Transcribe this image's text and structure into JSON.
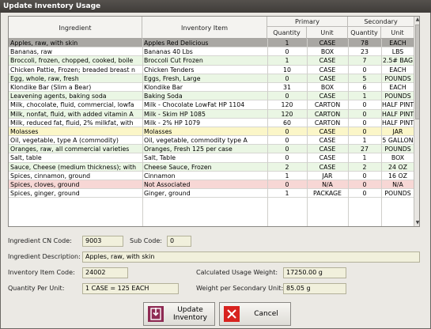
{
  "window": {
    "title": "Update Inventory Usage"
  },
  "table": {
    "headers": {
      "ingredient": "Ingredient",
      "inventory_item": "Inventory Item",
      "primary": "Primary",
      "secondary": "Secondary",
      "quantity": "Quantity",
      "unit": "Unit"
    },
    "rows": [
      {
        "ingredient": "Apples, raw, with skin",
        "item": "Apples Red Delicious",
        "pq": "1",
        "pu": "CASE",
        "sq": "78",
        "su": "EACH",
        "state": "selected"
      },
      {
        "ingredient": "Bananas, raw",
        "item": "Bananas 40 Lbs",
        "pq": "0",
        "pu": "BOX",
        "sq": "23",
        "su": "LBS",
        "state": "normal"
      },
      {
        "ingredient": "Broccoli, frozen, chopped, cooked, boile",
        "item": "Broccoli Cut Frozen",
        "pq": "1",
        "pu": "CASE",
        "sq": "7",
        "su": "2.5# BAG",
        "state": "green"
      },
      {
        "ingredient": "Chicken Pattie, Frozen; breaded breast n",
        "item": "Chicken Tenders",
        "pq": "10",
        "pu": "CASE",
        "sq": "0",
        "su": "EACH",
        "state": "normal"
      },
      {
        "ingredient": "Egg, whole, raw, fresh",
        "item": "Eggs, Fresh, Large",
        "pq": "0",
        "pu": "CASE",
        "sq": "5",
        "su": "POUNDS",
        "state": "green"
      },
      {
        "ingredient": "Klondike Bar (Slim a Bear)",
        "item": "Klondike Bar",
        "pq": "31",
        "pu": "BOX",
        "sq": "6",
        "su": "EACH",
        "state": "normal"
      },
      {
        "ingredient": "Leavening agents, baking soda",
        "item": "Baking Soda",
        "pq": "0",
        "pu": "CASE",
        "sq": "1",
        "su": "POUNDS",
        "state": "green"
      },
      {
        "ingredient": "Milk, chocolate, fluid, commercial, lowfa",
        "item": "Milk - Chocolate LowFat HP 1104",
        "pq": "120",
        "pu": "CARTON",
        "sq": "0",
        "su": "HALF PINT",
        "state": "normal"
      },
      {
        "ingredient": "Milk, nonfat, fluid, with added vitamin A",
        "item": "Milk - Skim HP 1085",
        "pq": "120",
        "pu": "CARTON",
        "sq": "0",
        "su": "HALF PINT",
        "state": "green"
      },
      {
        "ingredient": "Milk, reduced fat, fluid, 2% milkfat, with",
        "item": "Milk - 2% HP 1079",
        "pq": "60",
        "pu": "CARTON",
        "sq": "0",
        "su": "HALF PINT",
        "state": "normal"
      },
      {
        "ingredient": "Molasses",
        "item": "Molasses",
        "pq": "0",
        "pu": "CASE",
        "sq": "0",
        "su": "JAR",
        "state": "yellow"
      },
      {
        "ingredient": "Oil, vegetable, type A (commodity)",
        "item": "Oil, vegetable, commodity type A",
        "pq": "0",
        "pu": "CASE",
        "sq": "1",
        "su": "5 GALLON",
        "state": "normal"
      },
      {
        "ingredient": "Oranges, raw, all commercial varieties",
        "item": "Oranges, Fresh 125 per case",
        "pq": "0",
        "pu": "CASE",
        "sq": "27",
        "su": "POUNDS",
        "state": "green"
      },
      {
        "ingredient": "Salt, table",
        "item": "Salt, Table",
        "pq": "0",
        "pu": "CASE",
        "sq": "1",
        "su": "BOX",
        "state": "normal"
      },
      {
        "ingredient": "Sauce, Cheese (medium thickness); with",
        "item": "Cheese Sauce, Frozen",
        "pq": "2",
        "pu": "CASE",
        "sq": "2",
        "su": "24 OZ",
        "state": "green"
      },
      {
        "ingredient": "Spices, cinnamon, ground",
        "item": "Cinnamon",
        "pq": "1",
        "pu": "JAR",
        "sq": "0",
        "su": "16 OZ",
        "state": "normal"
      },
      {
        "ingredient": "Spices, cloves, ground",
        "item": "Not Associated",
        "pq": "0",
        "pu": "N/A",
        "sq": "0",
        "su": "N/A",
        "state": "red"
      },
      {
        "ingredient": "Spices, ginger, ground",
        "item": "Ginger, ground",
        "pq": "1",
        "pu": "PACKAGE",
        "sq": "0",
        "su": "POUNDS",
        "state": "normal"
      }
    ]
  },
  "form": {
    "ingredient_cn_code_label": "Ingredient CN Code:",
    "ingredient_cn_code": "9003",
    "sub_code_label": "Sub Code:",
    "sub_code": "0",
    "ingredient_description_label": "Ingredient Description:",
    "ingredient_description": "Apples, raw, with skin",
    "inventory_item_code_label": "Inventory Item Code:",
    "inventory_item_code": "24002",
    "calculated_usage_weight_label": "Calculated Usage Weight:",
    "calculated_usage_weight": "17250.00 g",
    "quantity_per_unit_label": "Quantity Per Unit:",
    "quantity_per_unit": "1 CASE = 125 EACH",
    "weight_per_secondary_unit_label": "Weight per Secondary Unit:",
    "weight_per_secondary_unit": "85.05 g"
  },
  "buttons": {
    "update_label": "Update Inventory",
    "cancel_label": "Cancel"
  },
  "colors": {
    "selected": "#a9a7a3",
    "green": "#eaf6e4",
    "yellow": "#fbf6c8",
    "red": "#f7d7d5",
    "normal": "#ffffff",
    "update_icon": "#8e2a53",
    "cancel_icon": "#d8231f"
  },
  "icons": {
    "update": "import-icon",
    "cancel": "close-icon"
  }
}
